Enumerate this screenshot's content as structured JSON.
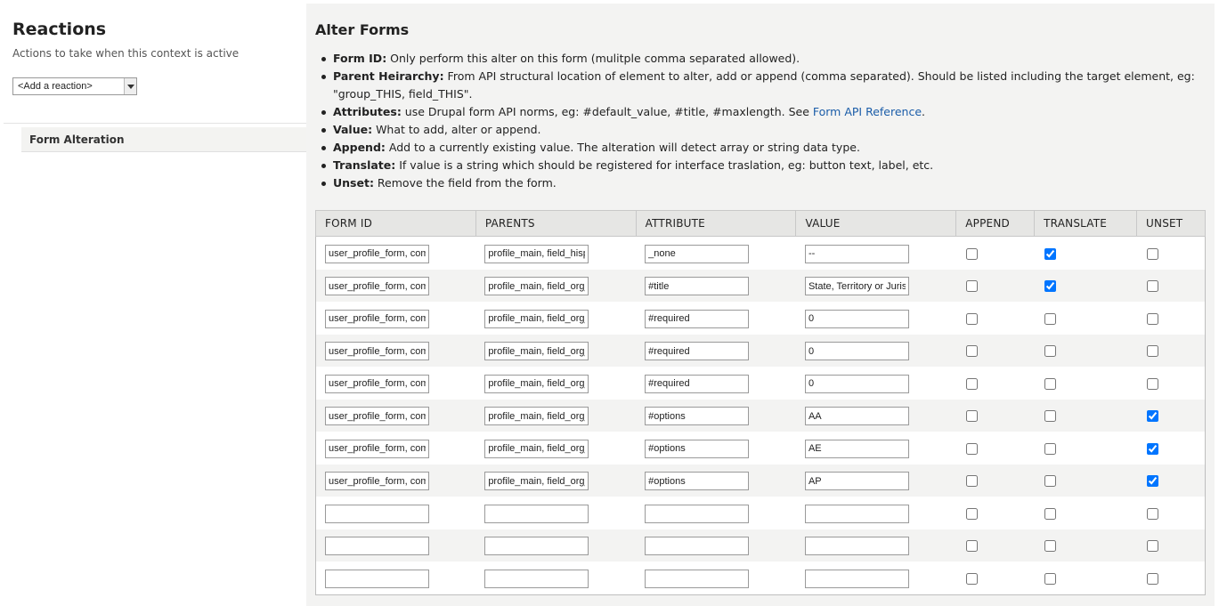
{
  "left": {
    "title": "Reactions",
    "description": "Actions to take when this context is active",
    "select_value": "<Add a reaction>",
    "vertical_tab": "Form Alteration"
  },
  "panel": {
    "title": "Alter Forms",
    "help": [
      {
        "term": "Form ID:",
        "text": " Only perform this alter on this form (mulitple comma separated allowed)."
      },
      {
        "term": "Parent Heirarchy:",
        "text": " From API structural location of element to alter, add or append (comma separated). Should be listed including the target element, eg: \"group_THIS, field_THIS\"."
      },
      {
        "term": "Attributes:",
        "text": " use Drupal form API norms, eg: #default_value, #title, #maxlength. See ",
        "link": "Form API Reference",
        "after": "."
      },
      {
        "term": "Value:",
        "text": " What to add, alter or append."
      },
      {
        "term": "Append:",
        "text": " Add to a currently existing value. The alteration will detect array or string data type."
      },
      {
        "term": "Translate:",
        "text": " If value is a string which should be registered for interface traslation, eg: button text, label, etc."
      },
      {
        "term": "Unset:",
        "text": " Remove the field from the form."
      }
    ]
  },
  "table": {
    "headers": [
      "FORM ID",
      "PARENTS",
      "ATTRIBUTE",
      "VALUE",
      "APPEND",
      "TRANSLATE",
      "UNSET"
    ],
    "rows": [
      {
        "form_id": "user_profile_form, com",
        "parents": "profile_main, field_hisp",
        "attribute": "_none",
        "value": "--",
        "append": false,
        "translate": true,
        "unset": false
      },
      {
        "form_id": "user_profile_form, com",
        "parents": "profile_main, field_org_",
        "attribute": "#title",
        "value": "State, Territory or Juris",
        "append": false,
        "translate": true,
        "unset": false
      },
      {
        "form_id": "user_profile_form, com",
        "parents": "profile_main, field_org_",
        "attribute": "#required",
        "value": "0",
        "append": false,
        "translate": false,
        "unset": false
      },
      {
        "form_id": "user_profile_form, com",
        "parents": "profile_main, field_org_",
        "attribute": "#required",
        "value": "0",
        "append": false,
        "translate": false,
        "unset": false
      },
      {
        "form_id": "user_profile_form, com",
        "parents": "profile_main, field_org_",
        "attribute": "#required",
        "value": "0",
        "append": false,
        "translate": false,
        "unset": false
      },
      {
        "form_id": "user_profile_form, com",
        "parents": "profile_main, field_org_",
        "attribute": "#options",
        "value": "AA",
        "append": false,
        "translate": false,
        "unset": true
      },
      {
        "form_id": "user_profile_form, com",
        "parents": "profile_main, field_org_",
        "attribute": "#options",
        "value": "AE",
        "append": false,
        "translate": false,
        "unset": true
      },
      {
        "form_id": "user_profile_form, com",
        "parents": "profile_main, field_org_",
        "attribute": "#options",
        "value": "AP",
        "append": false,
        "translate": false,
        "unset": true
      },
      {
        "form_id": "",
        "parents": "",
        "attribute": "",
        "value": "",
        "append": false,
        "translate": false,
        "unset": false
      },
      {
        "form_id": "",
        "parents": "",
        "attribute": "",
        "value": "",
        "append": false,
        "translate": false,
        "unset": false
      },
      {
        "form_id": "",
        "parents": "",
        "attribute": "",
        "value": "",
        "append": false,
        "translate": false,
        "unset": false
      }
    ]
  }
}
